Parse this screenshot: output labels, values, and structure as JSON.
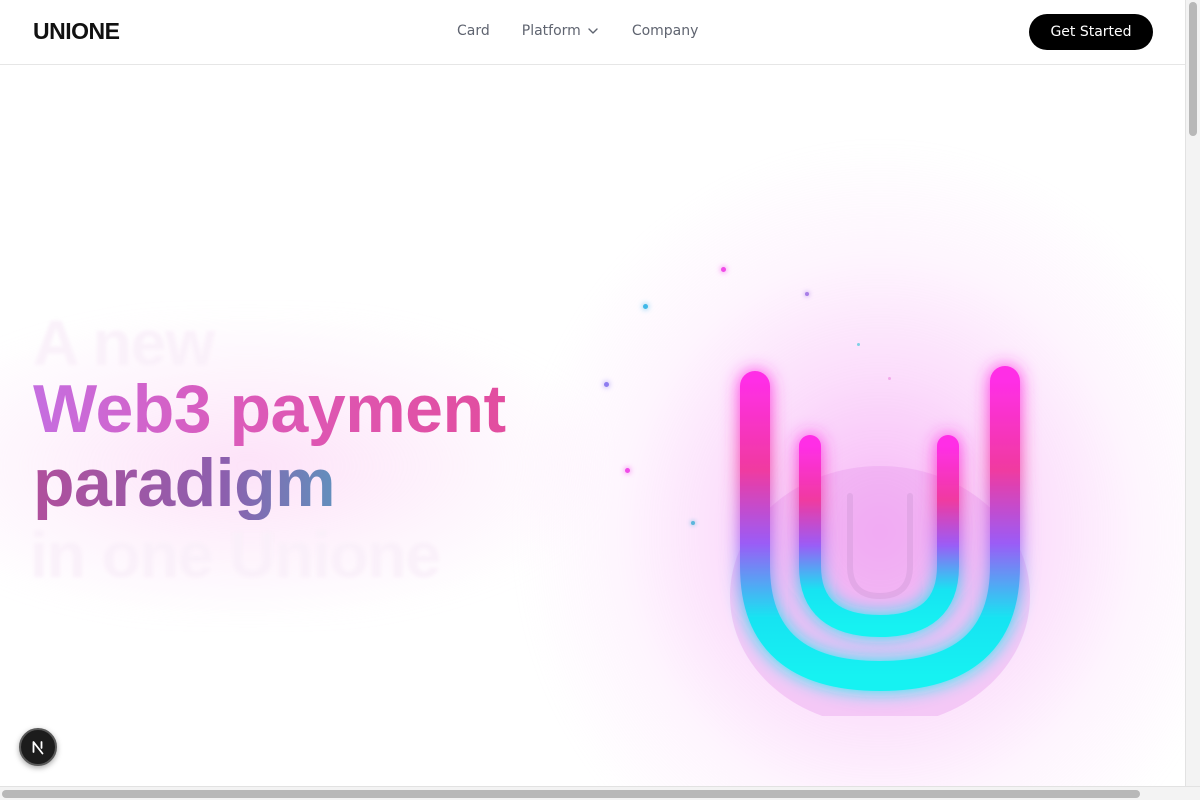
{
  "brand": {
    "logo_text": "UNIONE"
  },
  "nav": {
    "items": [
      {
        "label": "Card"
      },
      {
        "label": "Platform",
        "has_dropdown": true,
        "icon": "chevron-down-icon"
      },
      {
        "label": "Company"
      }
    ],
    "cta_label": "Get Started"
  },
  "hero": {
    "ghost_top": "A new",
    "headline_line1": "Web3 payment",
    "headline_line2": "paradigm",
    "ghost_bottom": "in one Unione",
    "logo_graphic": "neon-u-logo"
  },
  "badge": {
    "label": "N",
    "icon": "nextjs-logo-icon"
  },
  "colors": {
    "accent_pink": "#ff2ee6",
    "accent_cyan": "#19f2f2",
    "accent_violet": "#9b5cf6",
    "button_bg": "#000000",
    "nav_text": "#5f6470"
  }
}
